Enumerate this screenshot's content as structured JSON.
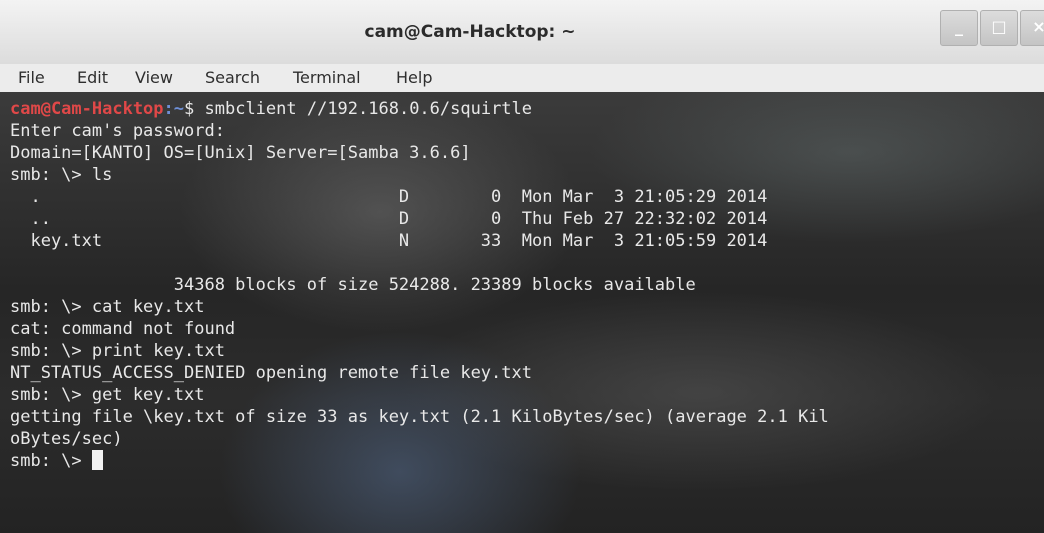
{
  "window": {
    "title": "cam@Cam-Hacktop: ~",
    "minimize_label": "_",
    "maximize_label": "□",
    "close_label": "×"
  },
  "menu": {
    "items": [
      "File",
      "Edit",
      "View",
      "Search",
      "Terminal",
      "Help"
    ]
  },
  "terminal": {
    "prompt_user": "cam@Cam-Hacktop",
    "prompt_path": ":~",
    "prompt_symbol": "$ ",
    "first_command": "smbclient //192.168.0.6/squirtle",
    "lines": [
      "Enter cam's password:",
      "Domain=[KANTO] OS=[Unix] Server=[Samba 3.6.6]",
      "smb: \\> ls",
      "  .                                   D        0  Mon Mar  3 21:05:29 2014",
      "  ..                                  D        0  Thu Feb 27 22:32:02 2014",
      "  key.txt                             N       33  Mon Mar  3 21:05:59 2014",
      "",
      "                34368 blocks of size 524288. 23389 blocks available",
      "smb: \\> cat key.txt",
      "cat: command not found",
      "smb: \\> print key.txt",
      "NT_STATUS_ACCESS_DENIED opening remote file key.txt",
      "smb: \\> get key.txt",
      "getting file \\key.txt of size 33 as key.txt (2.1 KiloBytes/sec) (average 2.1 Kil",
      "oBytes/sec)"
    ],
    "last_prompt": "smb: \\> "
  }
}
